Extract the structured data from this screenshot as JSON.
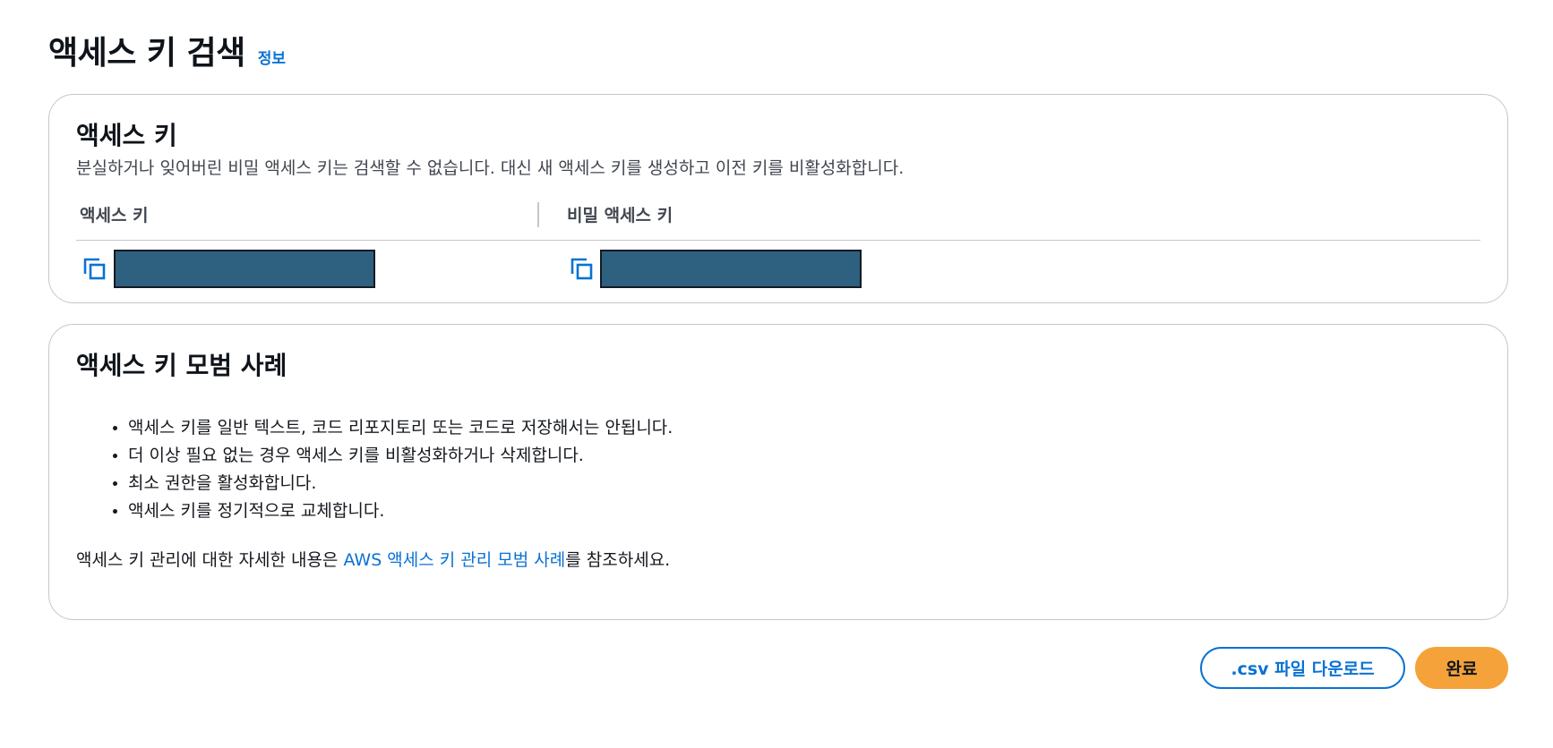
{
  "header": {
    "title": "액세스 키 검색",
    "info_link": "정보"
  },
  "access_keys_card": {
    "title": "액세스 키",
    "description": "분실하거나 잊어버린 비밀 액세스 키는 검색할 수 없습니다. 대신 새 액세스 키를 생성하고 이전 키를 비활성화합니다.",
    "columns": [
      "액세스 키",
      "비밀 액세스 키"
    ],
    "icons": {
      "copy": "copy-icon"
    },
    "colors": {
      "redacted": "#2e6080"
    }
  },
  "best_practices_card": {
    "title": "액세스 키 모범 사례",
    "items": [
      "액세스 키를 일반 텍스트, 코드 리포지토리 또는 코드로 저장해서는 안됩니다.",
      "더 이상 필요 없는 경우 액세스 키를 비활성화하거나 삭제합니다.",
      "최소 권한을 활성화합니다.",
      "액세스 키를 정기적으로 교체합니다."
    ],
    "footer_prefix": "액세스 키 관리에 대한 자세한 내용은 ",
    "footer_link": "AWS 액세스 키 관리 모범 사례",
    "footer_suffix": "를 참조하세요."
  },
  "actions": {
    "download_csv": ".csv 파일 다운로드",
    "done": "완료"
  },
  "colors": {
    "link": "#0972d3",
    "primary_button": "#f5a23a"
  }
}
